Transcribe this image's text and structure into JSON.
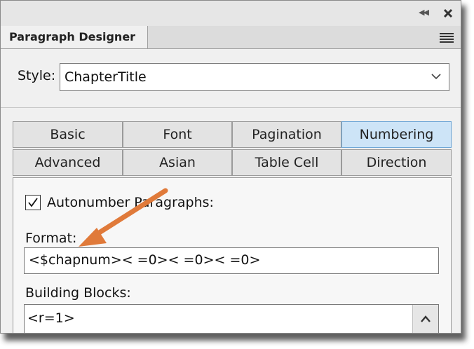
{
  "panel": {
    "title": "Paragraph Designer",
    "icons": {
      "collapse": "double-chevron-left-icon",
      "close": "close-icon",
      "menu": "hamburger-menu-icon"
    }
  },
  "style": {
    "label": "Style:",
    "value": "ChapterTitle"
  },
  "tabs": {
    "row1": [
      "Basic",
      "Font",
      "Pagination",
      "Numbering"
    ],
    "row2": [
      "Advanced",
      "Asian",
      "Table Cell",
      "Direction"
    ],
    "active": "Numbering"
  },
  "numbering": {
    "autonumber_label": "Autonumber Paragraphs:",
    "autonumber_checked": true,
    "format_label": "Format:",
    "format_value": "<$chapnum>< =0>< =0>< =0>",
    "building_blocks_label": "Building Blocks:",
    "building_blocks_items": [
      "<r=1>"
    ]
  },
  "colors": {
    "active_tab": "#cde4f7",
    "annotation_arrow": "#e07a3a"
  }
}
